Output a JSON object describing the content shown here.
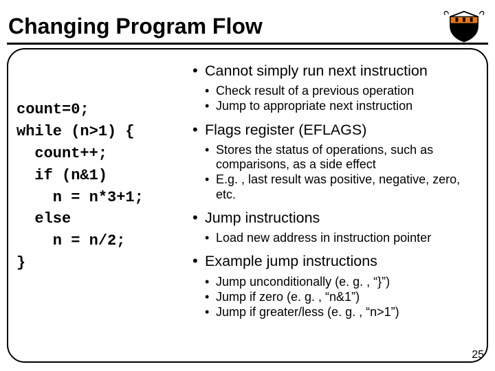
{
  "title": "Changing Program Flow",
  "code": "count=0;\nwhile (n>1) {\n  count++;\n  if (n&1)\n    n = n*3+1;\n  else\n    n = n/2;\n}",
  "bullets": [
    {
      "text": "Cannot simply run next instruction",
      "sub": [
        "Check result of a previous operation",
        "Jump to appropriate next instruction"
      ]
    },
    {
      "text": "Flags register (EFLAGS)",
      "sub": [
        "Stores the status of operations, such as comparisons, as a side effect",
        "E.g. , last result was positive, negative, zero, etc."
      ]
    },
    {
      "text": "Jump instructions",
      "sub": [
        "Load new address in instruction pointer"
      ]
    },
    {
      "text": "Example jump instructions",
      "sub": [
        "Jump unconditionally (e. g. , “}”)",
        "Jump if zero (e. g. , “n&1”)",
        "Jump if greater/less (e. g. , “n>1”)"
      ]
    }
  ],
  "page": "25"
}
